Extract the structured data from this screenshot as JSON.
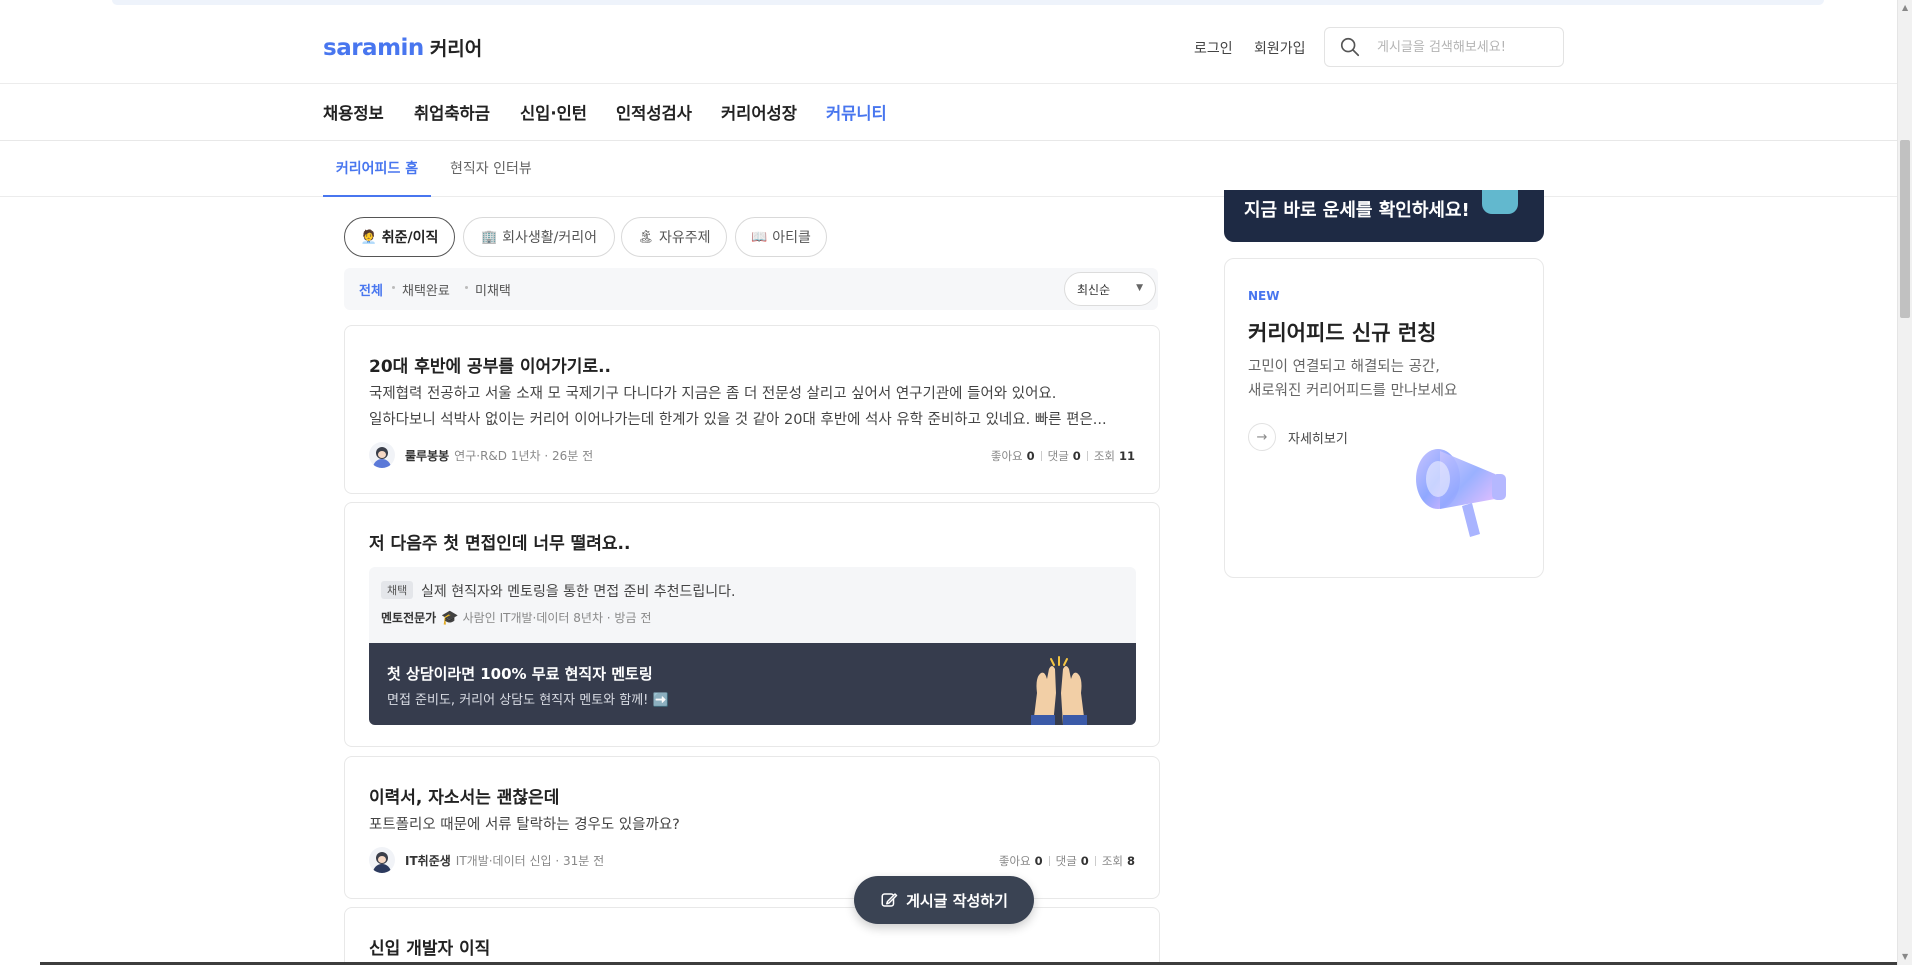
{
  "header": {
    "logo_brand": "saramin",
    "logo_sub": "커리어",
    "login": "로그인",
    "signup": "회원가입",
    "search_placeholder": "게시글을 검색해보세요!"
  },
  "gnb": [
    "채용정보",
    "취업축하금",
    "신입·인턴",
    "인적성검사",
    "커리어성장",
    "커뮤니티"
  ],
  "sub_tabs": [
    "커리어피드 홈",
    "현직자 인터뷰"
  ],
  "chips": [
    {
      "label": "취준/이직",
      "icon": "🧑‍💼"
    },
    {
      "label": "회사생활/커리어",
      "icon": "🏢"
    },
    {
      "label": "자유주제",
      "icon": "🏝"
    },
    {
      "label": "아티클",
      "icon": "📖"
    }
  ],
  "filters": [
    "전체",
    "채택완료",
    "미채택"
  ],
  "sort": "최신순",
  "posts": [
    {
      "title": "20대 후반에 공부를 이어가기로..",
      "body1": "국제협력 전공하고 서울 소재 모 국제기구 다니다가 지금은 좀 더 전문성 살리고 싶어서 연구기관에 들어와 있어요.",
      "body2": "일하다보니 석박사 없이는 커리어 이어나가는데 한계가 있을 것 같아 20대 후반에 석사 유학 준비하고 있네요. 빠른 편은...",
      "author": "룰루봉봉",
      "meta": "연구·R&D 1년차 · 26분 전",
      "likes_label": "좋아요",
      "likes": "0",
      "comments_label": "댓글",
      "comments": "0",
      "views_label": "조회",
      "views": "11"
    },
    {
      "title": "저 다음주 첫 면접인데 너무 떨려요..",
      "answer_badge": "채택",
      "answer_text": "실제 현직자와 멘토링을 통한 면접 준비 추천드립니다.",
      "answer_author": "멘토전문가",
      "answer_meta": "사람인 IT개발·데이터 8년차 · 방금 전",
      "banner_title": "첫 상담이라면 100% 무료 현직자 멘토링",
      "banner_sub": "면접 준비도, 커리어 상담도 현직자 멘토와 함께! ➡️"
    },
    {
      "title": "이력서, 자소서는 괜찮은데",
      "body1": "포트폴리오 때문에 서류 탈락하는 경우도 있을까요?",
      "author": "IT취준생",
      "meta": "IT개발·데이터 신입 · 31분 전",
      "likes_label": "좋아요",
      "likes": "0",
      "comments_label": "댓글",
      "comments": "0",
      "views_label": "조회",
      "views": "8"
    },
    {
      "title": "신입 개발자 이직"
    }
  ],
  "sidebar": {
    "banner_text": "지금 바로 운세를 확인하세요!",
    "new_label": "NEW",
    "title": "커리어피드 신규 런칭",
    "desc1": "고민이 연결되고 해결되는 공간,",
    "desc2": "새로워진 커리어피드를 만나보세요",
    "more": "자세히보기"
  },
  "write_button": "게시글 작성하기",
  "colors": {
    "accent": "#4876ef",
    "dark_banner": "#363c4d",
    "write_button": "#3a4353"
  }
}
